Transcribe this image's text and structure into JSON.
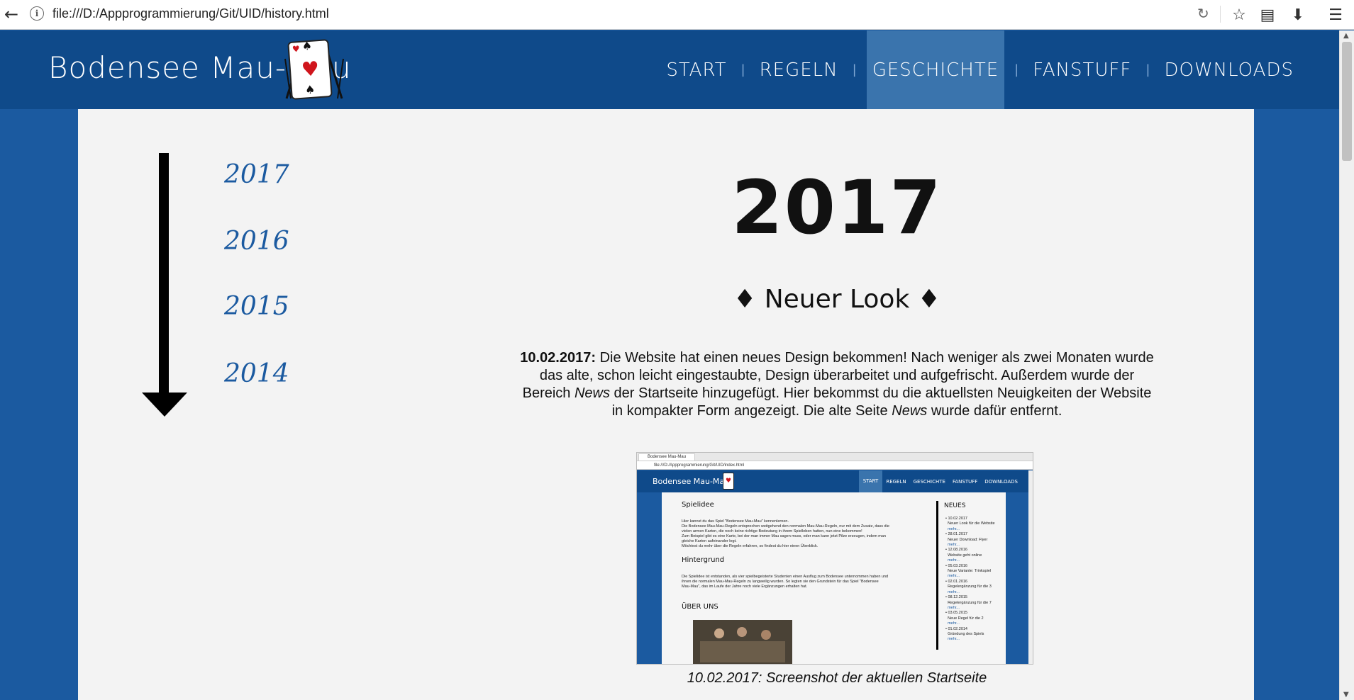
{
  "browser": {
    "url": "file:///D:/Appprogrammierung/Git/UID/history.html",
    "icons": [
      "back-arrow-icon",
      "info-icon",
      "reload-icon",
      "star-icon",
      "reading-list-icon",
      "download-icon",
      "menu-icon"
    ]
  },
  "header": {
    "logo_text": "Bodensee Mau-Mau",
    "nav": [
      {
        "label": "START"
      },
      {
        "label": "REGELN"
      },
      {
        "label": "GESCHICHTE",
        "active": true
      },
      {
        "label": "FANSTUFF"
      },
      {
        "label": "DOWNLOADS"
      }
    ],
    "nav_separator": "|"
  },
  "timeline": {
    "years": [
      "2017",
      "2016",
      "2015",
      "2014"
    ]
  },
  "content": {
    "year_heading": "2017",
    "news_title": "Neuer Look",
    "diamond": "♦",
    "news_date": "10.02.2017:",
    "news_text_1": " Die Website hat einen neues Design bekommen! Nach weniger als zwei Monaten wurde das alte, schon leicht eingestaubte, Design überarbeitet und aufgefrischt. Außerdem wurde der Bereich ",
    "news_em_1": "News",
    "news_text_2": " der Startseite hinzugefügt. Hier bekommst du die aktuellsten Neuigkeiten der Website in kompakter Form angezeigt. Die alte Seite ",
    "news_em_2": "News",
    "news_text_3": " wurde dafür entfernt.",
    "caption": "10.02.2017: Screenshot der aktuellen Startseite"
  },
  "screenshot": {
    "tab": "Bodensee Mau-Mau",
    "url": "file:///D:/Appprogrammierung/Git/UID/index.html",
    "logo": "Bodensee Mau-Mau",
    "nav": [
      "START",
      "REGELN",
      "GESCHICHTE",
      "FANSTUFF",
      "DOWNLOADS"
    ],
    "h_spielidee": "Spielidee",
    "p_spielidee_1": "Hier kannst du das Spiel \"Bodensee Mau-Mau\" kennenlernen.",
    "p_spielidee_2": "Die Bodensee Mau-Mau-Regeln entsprechen weitgehend den normalen Mau-Mau-Regeln, nur mit dem Zusatz, dass die",
    "p_spielidee_3": "vielen armen Karten, die noch keine richtige Bedeutung in ihrem Spielleben hatten, nun eine bekommen!",
    "p_spielidee_4": "Zum Beispiel gibt es eine Karte, bei der man immer Mau sagen muss, oder man kann jetzt Pilze erzeugen, indem man",
    "p_spielidee_5": "gleiche Karten aufeinander legt.",
    "p_spielidee_6": "Möchtest du mehr über die Regeln erfahren, so findest du hier einen Überblick.",
    "h_hintergrund": "Hintergrund",
    "p_hint_1": "Die Spielidee ist entstanden, als vier spielbegeisterte Studenten einen Ausflug zum Bodensee unternommen haben und",
    "p_hint_2": "ihnen die normalen Mau-Mau-Regeln zu langweilig wurden. So legten sie den Grundstein für das Spiel \"Bodensee",
    "p_hint_3": "Mau-Mau\", das im Laufe der Jahre noch viele Ergänzungen erhalten hat.",
    "h_ueber": "ÜBER UNS",
    "neues": "NEUES",
    "news": [
      {
        "date": "10.02.2017",
        "text": "Neuer Look für die Website",
        "more": "mehr..."
      },
      {
        "date": "28.01.2017",
        "text": "Neuer Download: Flyer",
        "more": "mehr..."
      },
      {
        "date": "12.08.2016",
        "text": "Website geht online",
        "more": "mehr..."
      },
      {
        "date": "05.03.2016",
        "text": "Neue Variante: Trinkspiel",
        "more": "mehr..."
      },
      {
        "date": "02.01.2016",
        "text": "Regelergänzung für die 3",
        "more": "mehr..."
      },
      {
        "date": "08.12.2015",
        "text": "Regelergänzung für die 7",
        "more": "mehr..."
      },
      {
        "date": "03.05.2015",
        "text": "Neue Regel für die 2",
        "more": "mehr..."
      },
      {
        "date": "01.02.2014",
        "text": "Gründung des Spiels",
        "more": "mehr..."
      }
    ]
  }
}
